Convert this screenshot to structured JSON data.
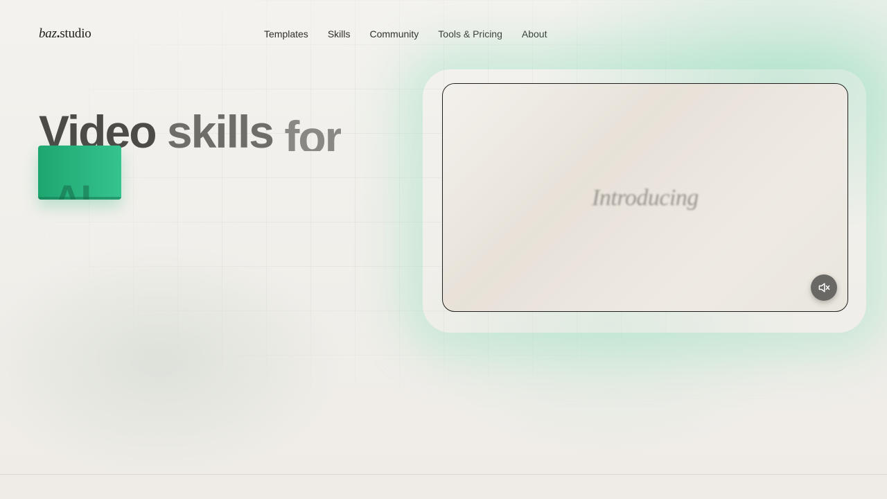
{
  "header": {
    "logo": {
      "brand": "baz",
      "dot": ".",
      "suffix": "studio"
    },
    "nav": [
      {
        "label": "Templates"
      },
      {
        "label": "Skills"
      },
      {
        "label": "Community"
      },
      {
        "label": "Tools & Pricing"
      },
      {
        "label": "About"
      }
    ]
  },
  "hero": {
    "title_words": [
      "Video",
      "skills",
      "for"
    ],
    "highlight_word": "AI"
  },
  "video": {
    "caption": "Introducing",
    "mute_icon": "speaker-muted-icon"
  },
  "colors": {
    "accent_green": "#2bb780",
    "text_dark": "#1d1d1b",
    "background": "#f1efea",
    "mute_button": "#6a6864"
  }
}
